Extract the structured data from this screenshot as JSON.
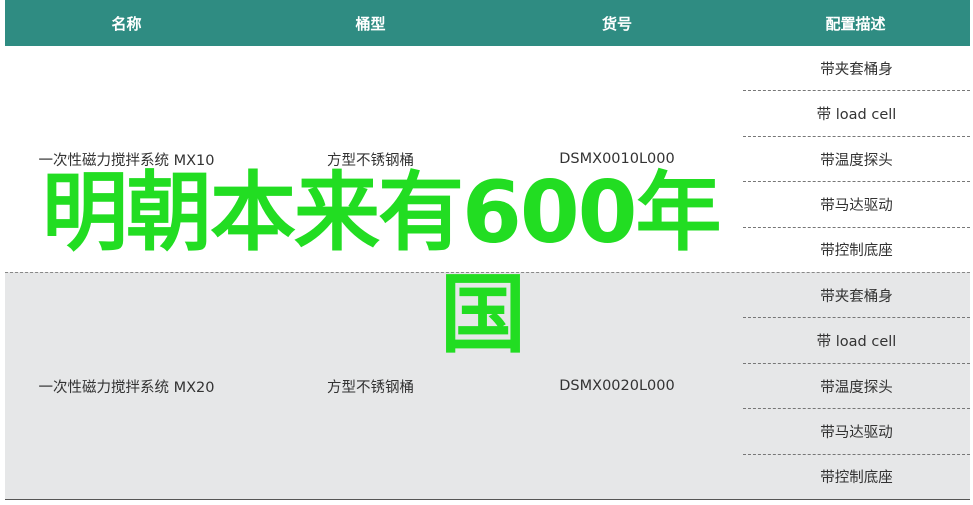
{
  "header": {
    "name": "名称",
    "bucket_type": "桶型",
    "item_no": "货号",
    "config": "配置描述"
  },
  "rows": [
    {
      "name": "一次性磁力搅拌系统 MX10",
      "bucket_type": "方型不锈钢桶",
      "item_no": "DSMX0010L000",
      "config": [
        "带夹套桶身",
        "带 load cell",
        "带温度探头",
        "带马达驱动",
        "带控制底座"
      ]
    },
    {
      "name": "一次性磁力搅拌系统 MX20",
      "bucket_type": "方型不锈钢桶",
      "item_no": "DSMX0020L000",
      "config": [
        "带夹套桶身",
        "带 load cell",
        "带温度探头",
        "带马达驱动",
        "带控制底座"
      ]
    }
  ],
  "overlay": {
    "line1": "明朝本来有600年",
    "line2": "国"
  },
  "colors": {
    "header_bg": "#2f8c82",
    "alt_row_bg": "#e6e7e8",
    "overlay_text": "#22dd22"
  }
}
